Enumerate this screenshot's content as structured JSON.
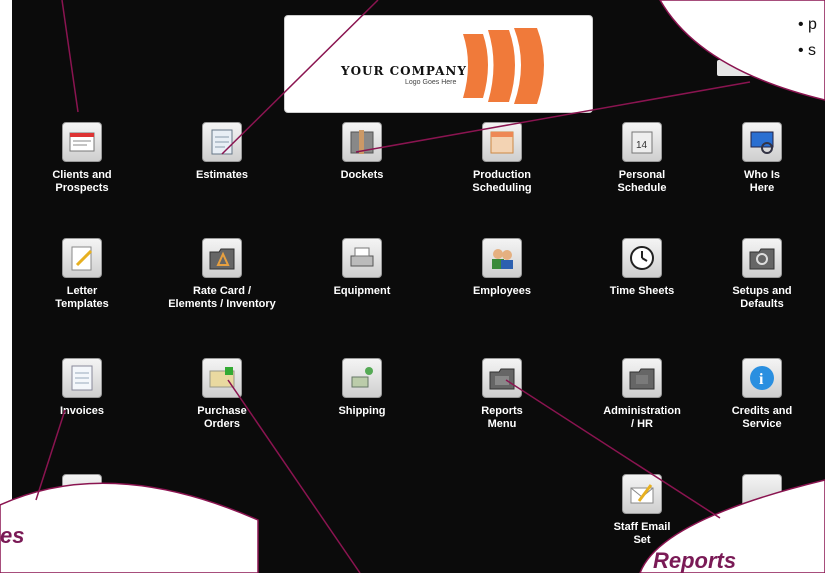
{
  "logo": {
    "company": "YOUR COMPANY",
    "tagline": "Logo Goes Here"
  },
  "tiles": [
    {
      "label": "Clients and\nProspects",
      "icon": "clients-prospects-icon"
    },
    {
      "label": "Estimates",
      "icon": "estimates-icon"
    },
    {
      "label": "Dockets",
      "icon": "dockets-icon"
    },
    {
      "label": "Production\nScheduling",
      "icon": "production-scheduling-icon"
    },
    {
      "label": "Personal\nSchedule",
      "icon": "calendar-icon"
    },
    {
      "label": "Who Is\nHere",
      "icon": "who-is-here-icon"
    },
    {
      "label": "Letter\nTemplates",
      "icon": "letter-templates-icon"
    },
    {
      "label": "Rate Card /\nElements / Inventory",
      "icon": "rate-card-folder-icon"
    },
    {
      "label": "Equipment",
      "icon": "printer-icon"
    },
    {
      "label": "Employees",
      "icon": "employees-icon"
    },
    {
      "label": "Time Sheets",
      "icon": "clock-icon"
    },
    {
      "label": "Setups and\nDefaults",
      "icon": "setups-folder-icon"
    },
    {
      "label": "Invoices",
      "icon": "invoices-icon"
    },
    {
      "label": "Purchase\nOrders",
      "icon": "purchase-orders-icon"
    },
    {
      "label": "Shipping",
      "icon": "shipping-icon"
    },
    {
      "label": "Reports\nMenu",
      "icon": "reports-folder-icon"
    },
    {
      "label": "Administration\n/ HR",
      "icon": "admin-folder-icon"
    },
    {
      "label": "Credits and\nService",
      "icon": "info-icon"
    },
    {
      "label": "Staff Email\nSet",
      "icon": "staff-email-icon"
    }
  ],
  "callouts": {
    "left_fragment": "es",
    "bottom_right": "Reports",
    "bullets": [
      "p",
      "s"
    ]
  },
  "colors": {
    "panel": "#0b0b0b",
    "callout_line": "#8a1450",
    "callout_text": "#7a1a56",
    "logo_accent": "#f07a3a"
  }
}
